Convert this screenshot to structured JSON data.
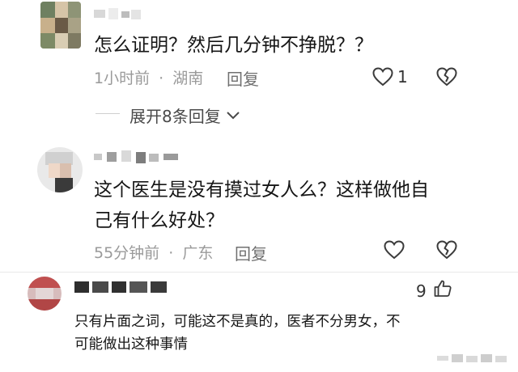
{
  "comments": [
    {
      "text": "怎么证明？然后几分钟不挣脱？？",
      "time": "1小时前",
      "location": "湖南",
      "reply_label": "回复",
      "like_count": "1",
      "expand_label": "展开8条回复"
    },
    {
      "text_line1": "这个医生是没有摸过女人么？这样做他自",
      "text_line2": "己有什么好处？",
      "time": "55分钟前",
      "location": "广东",
      "reply_label": "回复"
    },
    {
      "like_count": "9",
      "text_line1": "只有片面之词，可能这不是真的，医者不分男女，不",
      "text_line2": "可能做出这种事情"
    }
  ],
  "meta_separator": "·",
  "icons": {
    "like": "heart-outline-icon",
    "dislike": "broken-heart-icon",
    "expand": "chevron-down-icon",
    "thumb": "thumbs-up-icon"
  }
}
